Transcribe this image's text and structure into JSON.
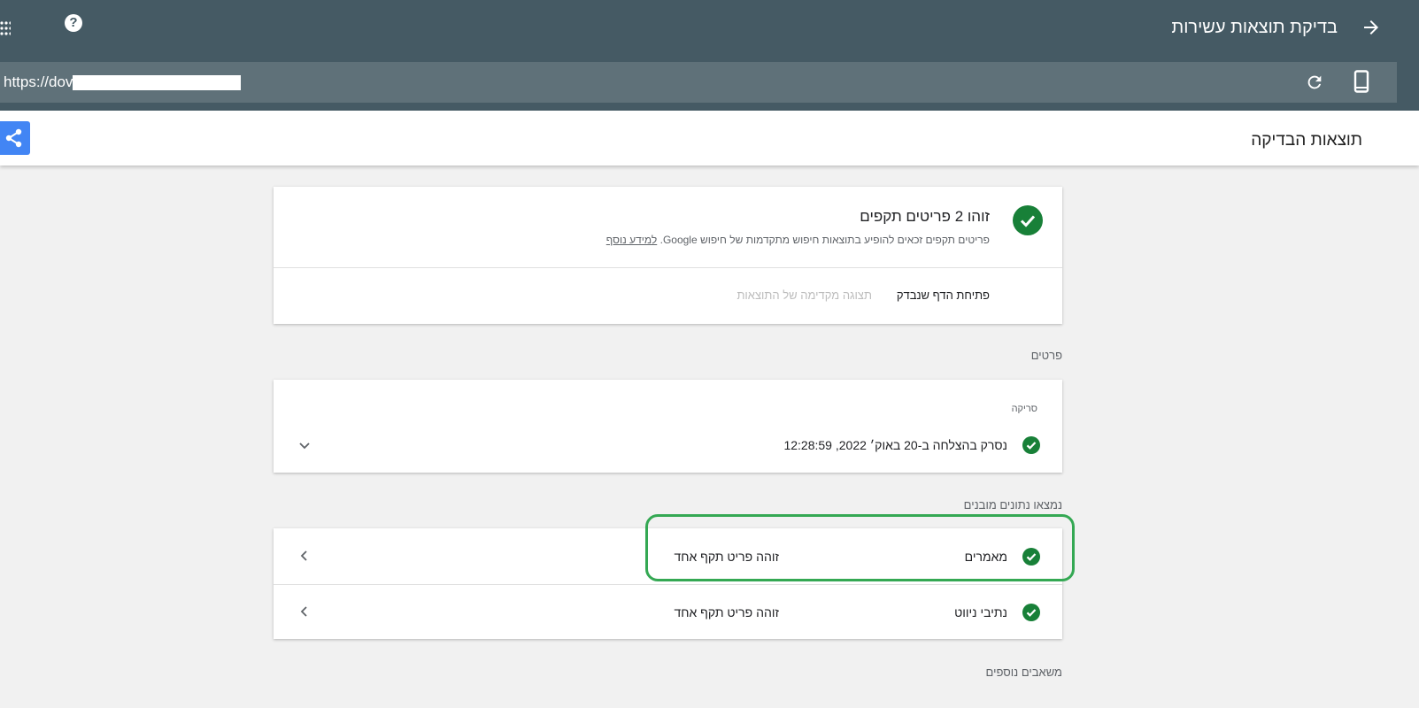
{
  "app": {
    "title": "בדיקת תוצאות עשירות",
    "url": "https://dovi",
    "icons": [
      "apps-icon",
      "help-icon",
      "arrow-forward-icon",
      "refresh-icon",
      "smartphone-icon",
      "share-icon"
    ]
  },
  "results_header": {
    "title": "תוצאות הבדיקה"
  },
  "summary": {
    "heading": "זוהו 2 פריטים תקפים",
    "description": "פריטים תקפים זכאים להופיע בתוצאות חיפוש מתקדמות של חיפוש Google.",
    "learn_more": "למידע נוסף",
    "tabs": [
      "פתיחת הדף שנבדק",
      "תצוגה מקדימה של התוצאות"
    ]
  },
  "details": {
    "section_label": "פרטים",
    "crawl_label": "סריקה",
    "crawl_status": "נסרק בהצלחה ב-20 באוק׳ 2022, 12:28:59"
  },
  "structured": {
    "section_label": "נמצאו נתונים מובנים",
    "items": [
      {
        "name": "מאמרים",
        "status": "זוהה פריט תקף אחד"
      },
      {
        "name": "נתיבי ניווט",
        "status": "זוהה פריט תקף אחד"
      }
    ]
  },
  "more_resources": {
    "label": "משאבים נוספים"
  },
  "colors": {
    "appbar": "#455a64",
    "url_bar": "#5f7179",
    "accent": "#4285f4",
    "success": "#188038",
    "highlight": "#34a853"
  }
}
